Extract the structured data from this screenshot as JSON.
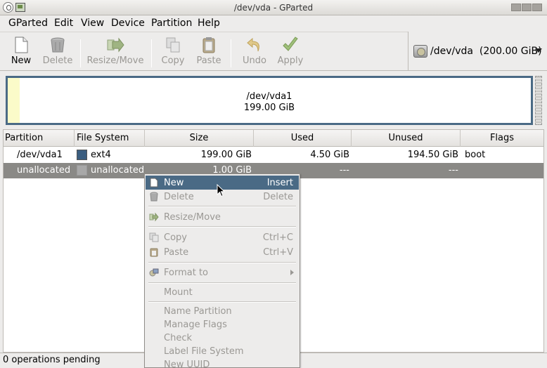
{
  "window": {
    "title": "/dev/vda - GParted"
  },
  "menubar": [
    "GParted",
    "Edit",
    "View",
    "Device",
    "Partition",
    "Help"
  ],
  "toolbar": {
    "new": "New",
    "delete": "Delete",
    "resize_move": "Resize/Move",
    "copy": "Copy",
    "paste": "Paste",
    "undo": "Undo",
    "apply": "Apply"
  },
  "device_selector": {
    "label": "/dev/vda  (200.00 GiB)"
  },
  "disk_visual": {
    "partition_name": "/dev/vda1",
    "partition_size": "199.00 GiB"
  },
  "table": {
    "headers": [
      "Partition",
      "File System",
      "Size",
      "Used",
      "Unused",
      "Flags"
    ],
    "rows": [
      {
        "partition": "/dev/vda1",
        "fs": "ext4",
        "size": "199.00 GiB",
        "used": "4.50 GiB",
        "unused": "194.50 GiB",
        "flags": "boot",
        "fs_color": "#3b5e80"
      },
      {
        "partition": "unallocated",
        "fs": "unallocated",
        "size": "1.00 GiB",
        "used": "---",
        "unused": "---",
        "flags": "",
        "fs_color": "#a8a8a8"
      }
    ]
  },
  "status": {
    "text": "0 operations pending"
  },
  "context_menu": {
    "items": [
      {
        "label": "New",
        "accel": "Insert",
        "icon": "new-document-icon"
      },
      {
        "label": "Delete",
        "accel": "Delete",
        "icon": "trash-icon"
      },
      {
        "label": "Resize/Move",
        "accel": "",
        "icon": "resize-icon"
      },
      {
        "label": "Copy",
        "accel": "Ctrl+C",
        "icon": "copy-icon"
      },
      {
        "label": "Paste",
        "accel": "Ctrl+V",
        "icon": "paste-icon"
      },
      {
        "label": "Format to",
        "accel": "",
        "icon": "format-icon"
      },
      {
        "label": "Mount",
        "accel": ""
      },
      {
        "label": "Name Partition",
        "accel": ""
      },
      {
        "label": "Manage Flags",
        "accel": ""
      },
      {
        "label": "Check",
        "accel": ""
      },
      {
        "label": "Label File System",
        "accel": ""
      },
      {
        "label": "New UUID",
        "accel": ""
      }
    ]
  },
  "colors": {
    "accent": "#4a6a85",
    "selection": "#8a8986",
    "ext4": "#3b5e80"
  }
}
